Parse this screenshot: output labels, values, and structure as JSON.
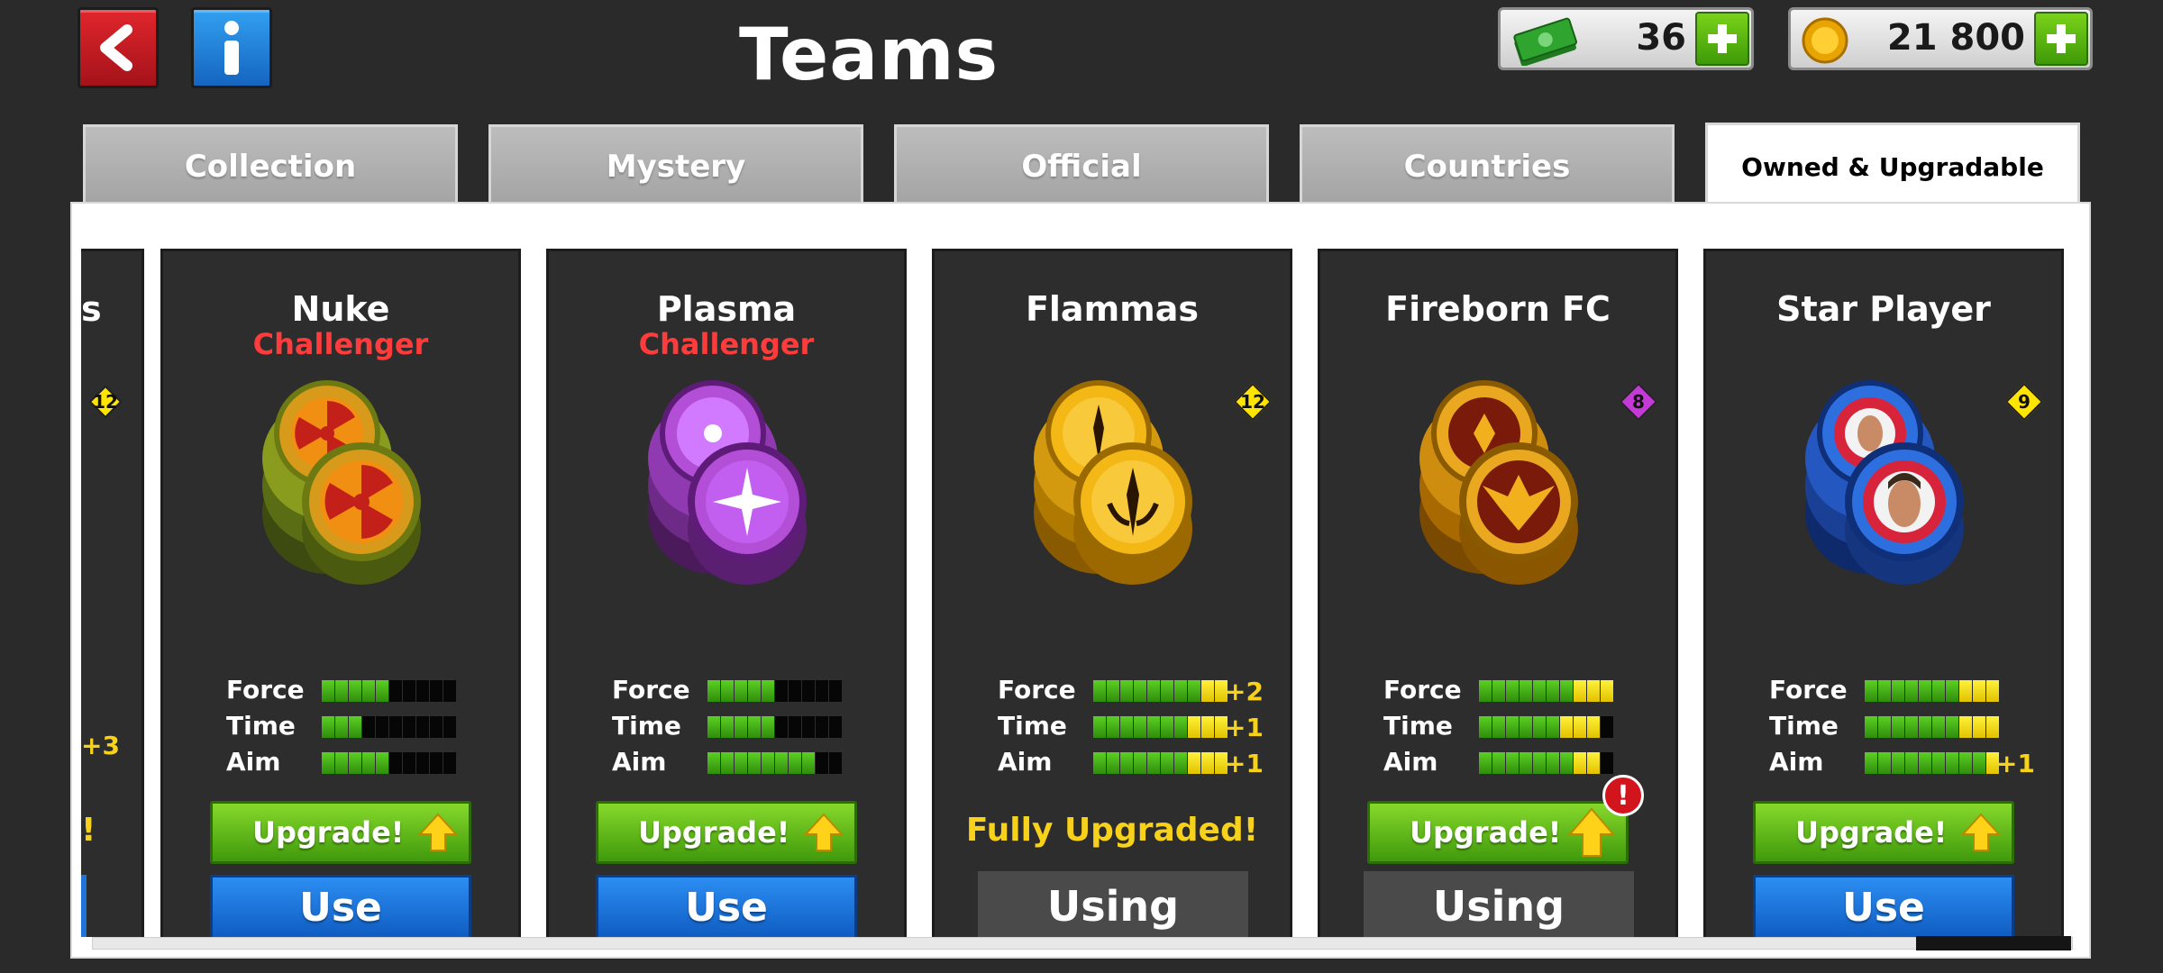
{
  "header": {
    "title": "Teams",
    "cash": "36",
    "coins": "21 800"
  },
  "tabs": [
    {
      "label": "Collection"
    },
    {
      "label": "Mystery"
    },
    {
      "label": "Official"
    },
    {
      "label": "Countries"
    },
    {
      "label": "Owned & Upgradable"
    }
  ],
  "active_tab": "Owned & Upgradable",
  "stat_labels": {
    "force": "Force",
    "time": "Time",
    "aim": "Aim"
  },
  "partial_card": {
    "name_fragment": "s",
    "level": "12",
    "bonus": "+3",
    "status_fragment": "!"
  },
  "cards": [
    {
      "name": "Nuke",
      "tier": "Challenger",
      "level": "",
      "stats": {
        "force": {
          "value": 5,
          "yellow": 0,
          "bonus": ""
        },
        "time": {
          "value": 3,
          "yellow": 0,
          "bonus": ""
        },
        "aim": {
          "value": 5,
          "yellow": 0,
          "bonus": ""
        }
      },
      "upgrade_label": "Upgrade!",
      "action_label": "Use",
      "theme": "nuke"
    },
    {
      "name": "Plasma",
      "tier": "Challenger",
      "level": "",
      "stats": {
        "force": {
          "value": 5,
          "yellow": 0,
          "bonus": ""
        },
        "time": {
          "value": 5,
          "yellow": 0,
          "bonus": ""
        },
        "aim": {
          "value": 8,
          "yellow": 0,
          "bonus": ""
        }
      },
      "upgrade_label": "Upgrade!",
      "action_label": "Use",
      "theme": "plasma"
    },
    {
      "name": "Flammas",
      "tier": "",
      "level": "12",
      "stats": {
        "force": {
          "value": 10,
          "yellow": 2,
          "bonus": "+2"
        },
        "time": {
          "value": 10,
          "yellow": 3,
          "bonus": "+1"
        },
        "aim": {
          "value": 10,
          "yellow": 3,
          "bonus": "+1"
        }
      },
      "status_text": "Fully Upgraded!",
      "action_label": "Using",
      "theme": "flammas"
    },
    {
      "name": "Fireborn FC",
      "tier": "",
      "level": "8",
      "stats": {
        "force": {
          "value": 10,
          "yellow": 3,
          "bonus": ""
        },
        "time": {
          "value": 9,
          "yellow": 3,
          "bonus": ""
        },
        "aim": {
          "value": 9,
          "yellow": 2,
          "bonus": ""
        }
      },
      "upgrade_label": "Upgrade!",
      "alert": "!",
      "action_label": "Using",
      "theme": "fireborn"
    },
    {
      "name": "Star Player",
      "tier": "",
      "level": "9",
      "stats": {
        "force": {
          "value": 10,
          "yellow": 3,
          "bonus": ""
        },
        "time": {
          "value": 10,
          "yellow": 3,
          "bonus": ""
        },
        "aim": {
          "value": 10,
          "yellow": 1,
          "bonus": "+1"
        }
      },
      "upgrade_label": "Upgrade!",
      "action_label": "Use",
      "theme": "star"
    }
  ],
  "colors": {
    "level_badge_yellow": "#ffe500",
    "level_badge_purple": "#c33ad6",
    "challenger_red": "#ff3b3b",
    "bonus_yellow": "#f8d21a"
  }
}
